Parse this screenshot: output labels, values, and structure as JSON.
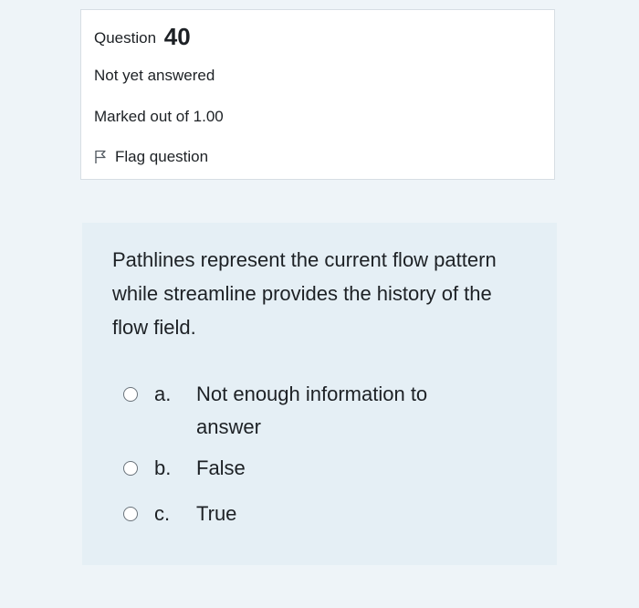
{
  "question": {
    "label": "Question",
    "number": "40",
    "state": "Not yet answered",
    "grade": "Marked out of 1.00",
    "flag_label": "Flag question"
  },
  "prompt": "Pathlines represent the current flow pattern while streamline provides the history of the flow field.",
  "answers": [
    {
      "letter": "a.",
      "text": "Not enough information to answer"
    },
    {
      "letter": "b.",
      "text": "False"
    },
    {
      "letter": "c.",
      "text": "True"
    }
  ],
  "colors": {
    "page_bg": "#eef4f8",
    "info_bg": "#ffffff",
    "content_bg": "#e5eff5",
    "text": "#1d2125"
  },
  "icons": {
    "flag": "flag-icon"
  }
}
